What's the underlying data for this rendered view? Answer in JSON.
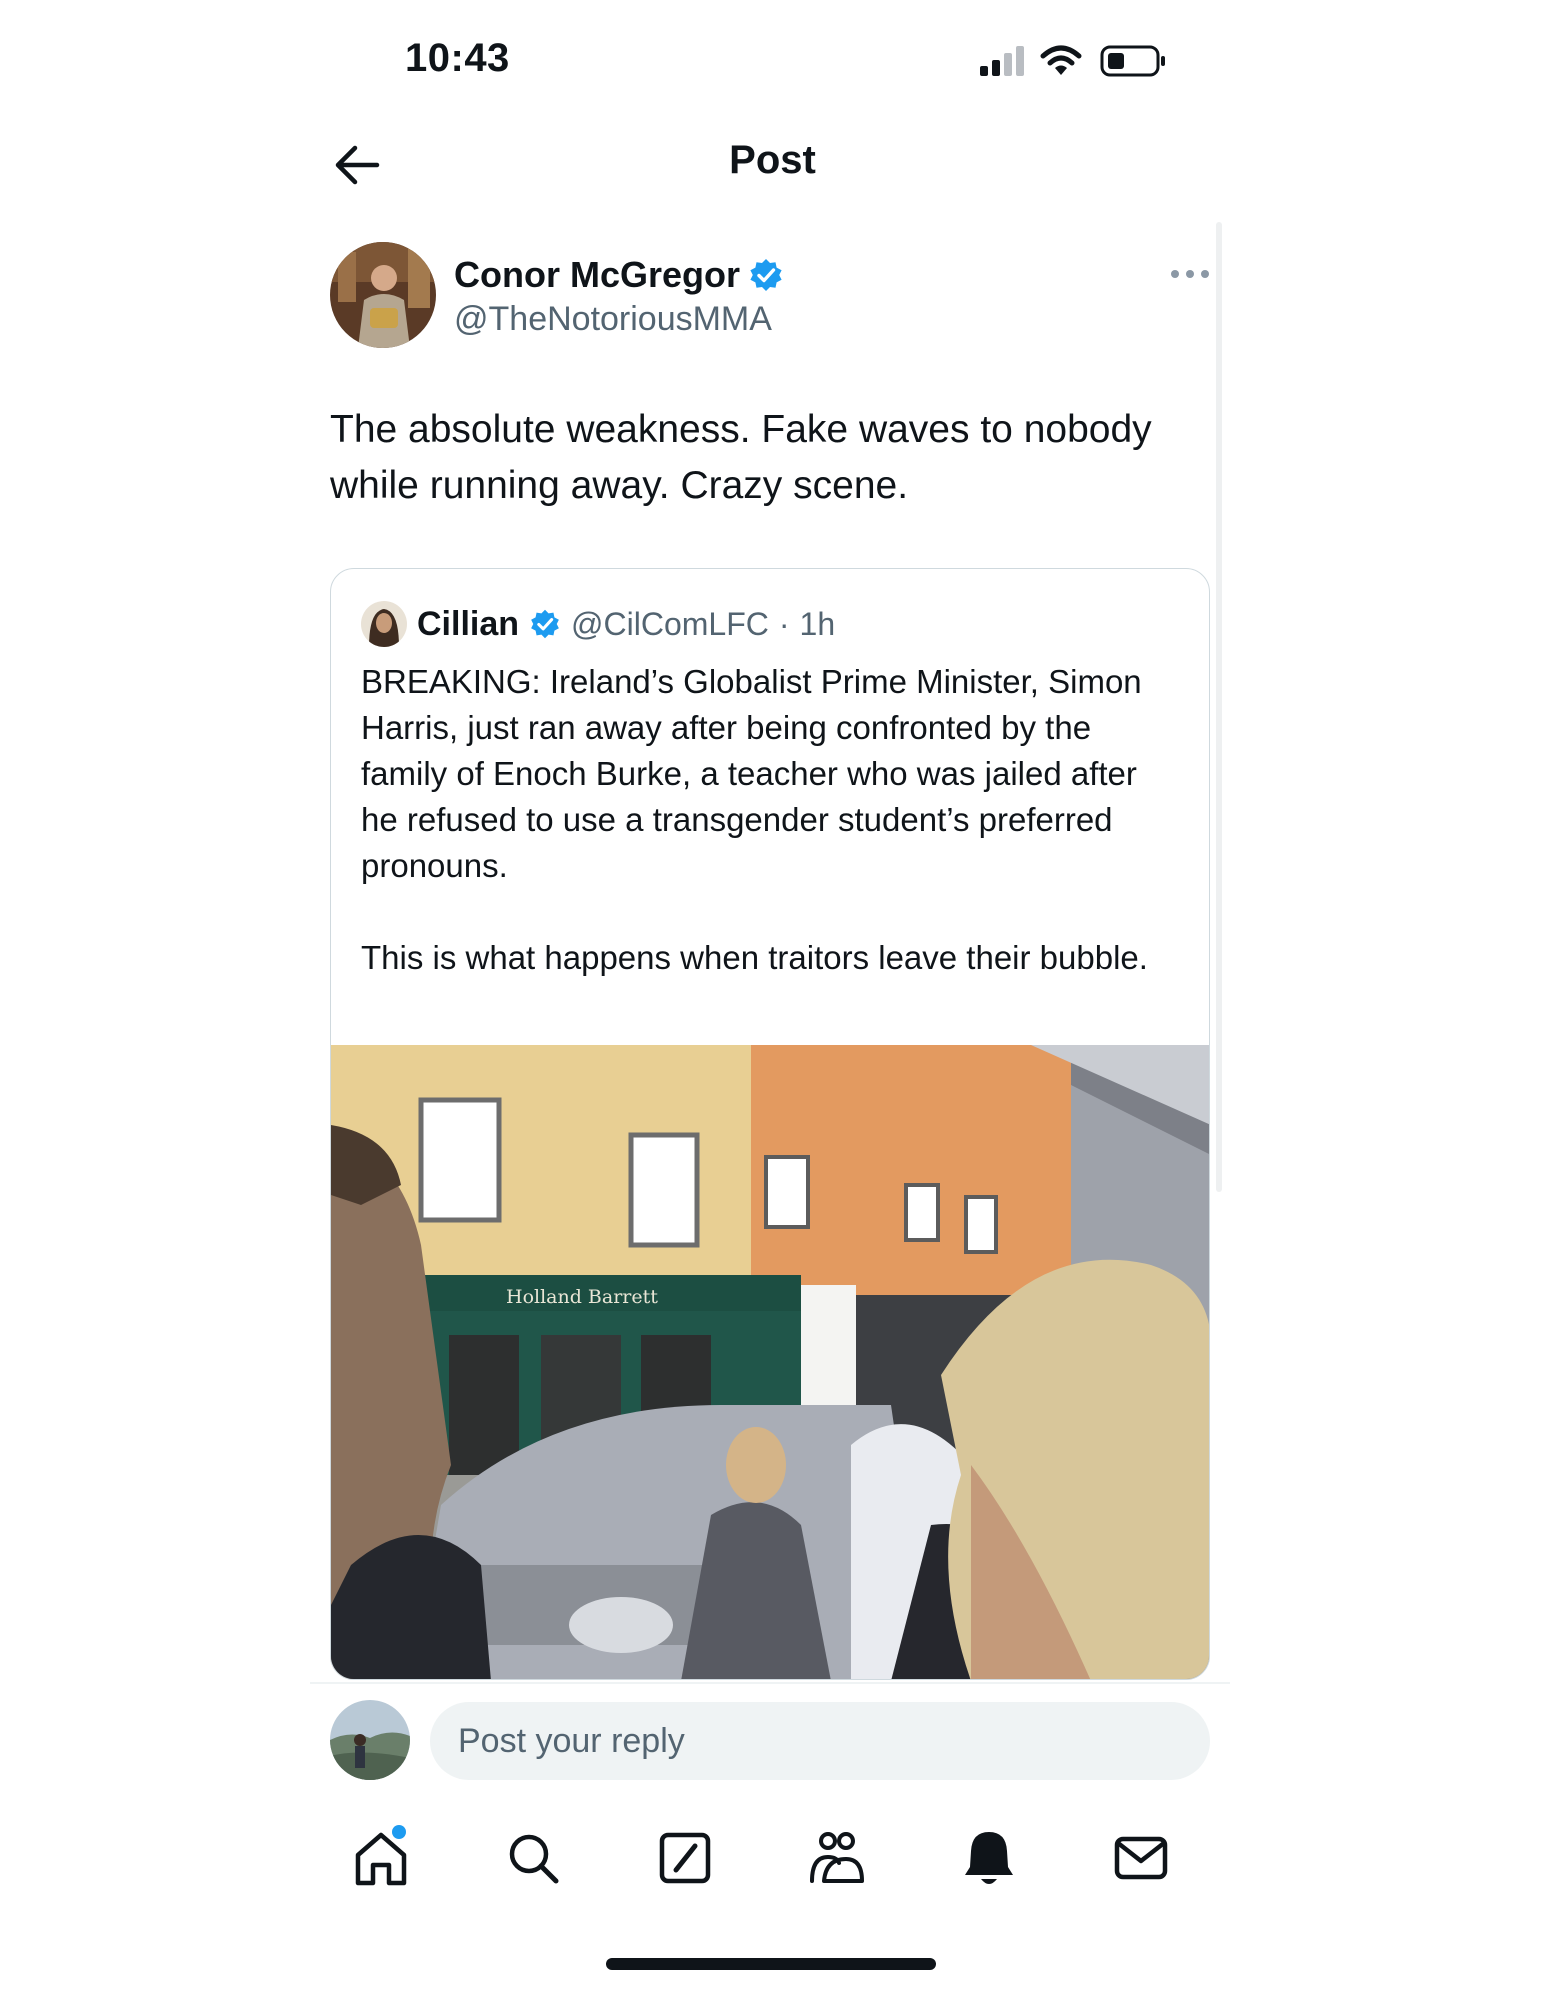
{
  "status_bar": {
    "time": "10:43"
  },
  "header": {
    "title": "Post"
  },
  "post": {
    "author_name": "Conor McGregor",
    "author_handle": "@TheNotoriousMMA",
    "verified": true,
    "text": "The absolute weakness. Fake waves to nobody while running away. Crazy scene."
  },
  "quoted_post": {
    "author_name": "Cillian",
    "author_handle": "@CilComLFC",
    "separator": "·",
    "time": "1h",
    "verified": true,
    "paragraph_1": "BREAKING: Ireland’s Globalist Prime Minister, Simon Harris, just ran away after being confronted by the family of Enoch Burke, a teacher who was jailed after he refused to use a transgender student’s preferred pronouns.",
    "paragraph_2": "This is what happens when traitors leave their bubble.",
    "media": {
      "storefront_sign": "Holland Barrett"
    }
  },
  "reply": {
    "placeholder": "Post your reply"
  },
  "tabs": [
    {
      "icon": "home-icon",
      "has_notification_dot": true
    },
    {
      "icon": "search-icon"
    },
    {
      "icon": "grok-icon"
    },
    {
      "icon": "communities-icon"
    },
    {
      "icon": "notifications-bell-icon"
    },
    {
      "icon": "messages-mail-icon"
    }
  ],
  "colors": {
    "accent": "#1d9bf0",
    "text": "#0f1419",
    "secondary_text": "#536471",
    "border": "#cfd9de"
  }
}
